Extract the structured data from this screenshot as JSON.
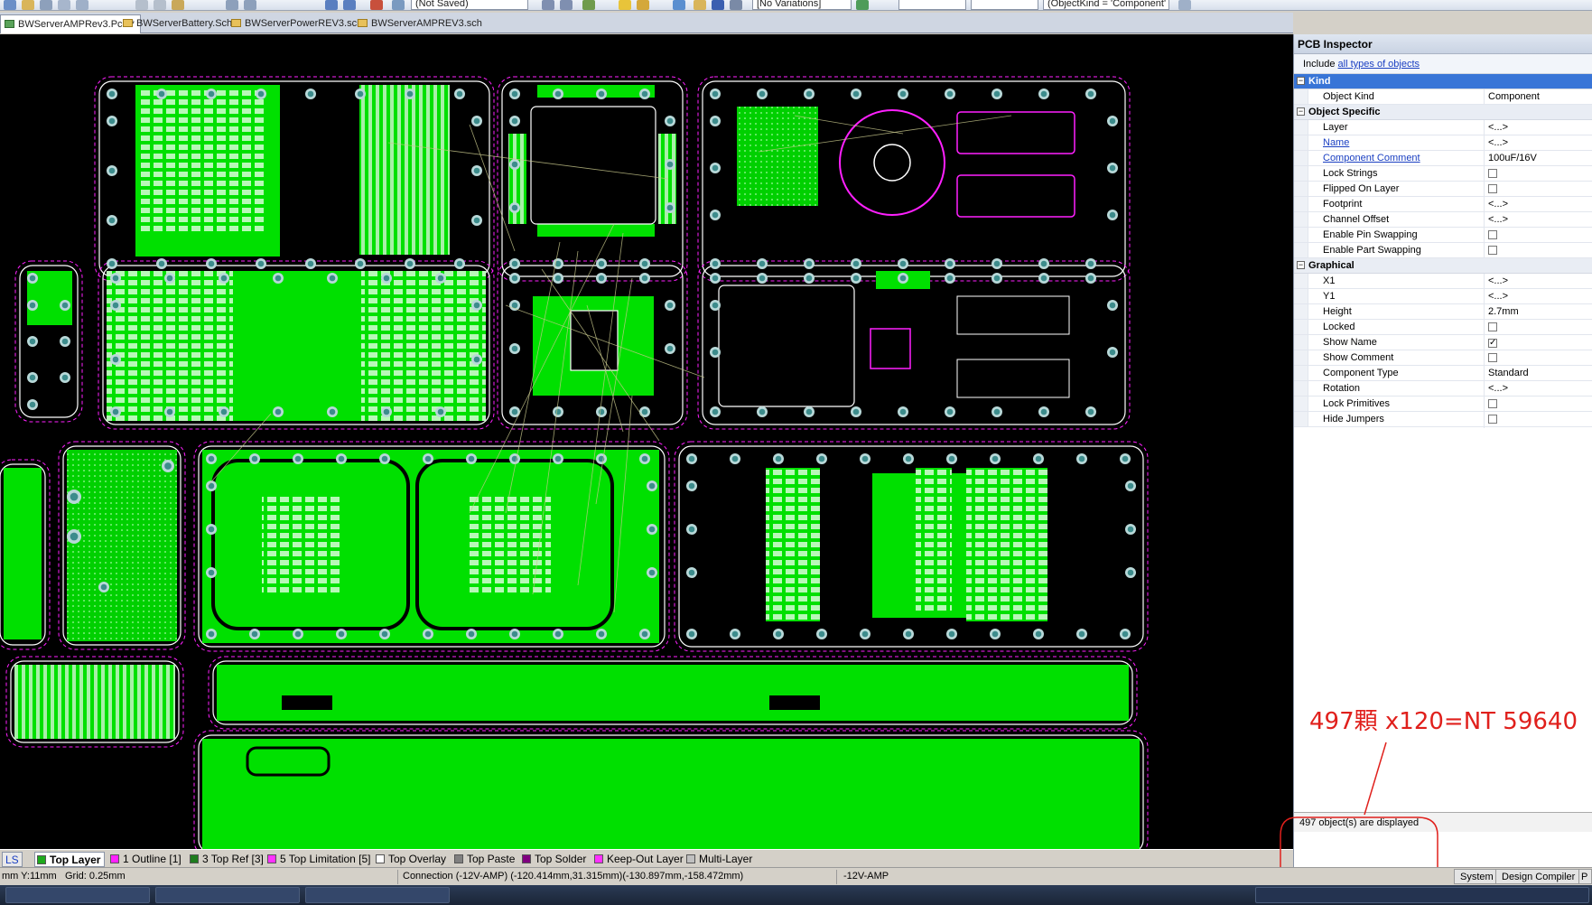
{
  "toolbar": {
    "combo_save": "(Not Saved)",
    "combo_variations": "[No Variations]",
    "combo_query": "(ObjectKind = 'Component'"
  },
  "doc_tabs": [
    {
      "label": "BWServerAMPRev3.Pcb *",
      "active": true
    },
    {
      "label": "BWServerBattery.Sch",
      "active": false
    },
    {
      "label": "BWServerPowerREV3.sch",
      "active": false
    },
    {
      "label": "BWServerAMPREV3.sch",
      "active": false
    }
  ],
  "layer_tabs": [
    {
      "label": "LS",
      "color": "#d4d0c8",
      "active": false
    },
    {
      "label": "Top Layer",
      "color": "#1eaa1e",
      "active": true
    },
    {
      "label": "1 Outline [1]",
      "color": "#ff20ff",
      "active": false
    },
    {
      "label": "3 Top Ref [3]",
      "color": "#1e7c1e",
      "active": false
    },
    {
      "label": "5 Top Limitation [5]",
      "color": "#ff30ff",
      "active": false
    },
    {
      "label": "Top Overlay",
      "color": "#ffffff",
      "active": false
    },
    {
      "label": "Top Paste",
      "color": "#808080",
      "active": false
    },
    {
      "label": "Top Solder",
      "color": "#800080",
      "active": false
    },
    {
      "label": "Keep-Out Layer",
      "color": "#ff30ff",
      "active": false
    },
    {
      "label": "Multi-Layer",
      "color": "#c0c0c0",
      "active": false
    }
  ],
  "inspector": {
    "title": "PCB Inspector",
    "include_prefix": "Include",
    "include_link": "all types of objects",
    "sections": [
      {
        "label": "Kind",
        "rows": [
          {
            "name": "Object Kind",
            "value": "Component",
            "link": false
          }
        ]
      },
      {
        "label": "Object Specific",
        "rows": [
          {
            "name": "Layer",
            "value": "<...>",
            "link": false
          },
          {
            "name": "Name",
            "value": "<...>",
            "link": true
          },
          {
            "name": "Component Comment",
            "value": "100uF/16V",
            "link": true
          },
          {
            "name": "Lock Strings",
            "check": false,
            "link": false
          },
          {
            "name": "Flipped On Layer",
            "check": false,
            "link": false
          },
          {
            "name": "Footprint",
            "value": "<...>",
            "link": false
          },
          {
            "name": "Channel Offset",
            "value": "<...>",
            "link": false
          },
          {
            "name": "Enable Pin Swapping",
            "check": false,
            "link": false
          },
          {
            "name": "Enable Part Swapping",
            "check": false,
            "link": false
          }
        ]
      },
      {
        "label": "Graphical",
        "rows": [
          {
            "name": "X1",
            "value": "<...>",
            "link": false
          },
          {
            "name": "Y1",
            "value": "<...>",
            "link": false
          },
          {
            "name": "Height",
            "value": "2.7mm",
            "link": false
          },
          {
            "name": "Locked",
            "check": false,
            "link": false
          },
          {
            "name": "Show Name",
            "check": true,
            "link": false
          },
          {
            "name": "Show Comment",
            "check": false,
            "link": false
          },
          {
            "name": "Component Type",
            "value": "Standard",
            "link": false
          },
          {
            "name": "Rotation",
            "value": "<...>",
            "link": false
          },
          {
            "name": "Lock Primitives",
            "check": false,
            "link": false
          },
          {
            "name": "Hide Jumpers",
            "check": false,
            "link": false
          }
        ]
      }
    ],
    "status": "497 object(s) are displayed"
  },
  "annotation": "497顆 x120=NT 59640",
  "status_bar": {
    "coords": "mm Y:11mm",
    "grid": "Grid: 0.25mm",
    "connection": "Connection (-12V-AMP) (-120.414mm,31.315mm)(-130.897mm,-158.472mm)",
    "net": "-12V-AMP",
    "btn_system": "System",
    "btn_design_compiler": "Design Compiler",
    "btn_p": "P"
  },
  "colors": {
    "copper": "#00e000",
    "board_bg": "#000000",
    "outline": "#ff20ff",
    "overlay": "#ffffff",
    "pad": "#3c8c8c",
    "ratsnest": "#c8c88c",
    "annotation": "#e0201c",
    "selected_row": "#3875d7"
  }
}
